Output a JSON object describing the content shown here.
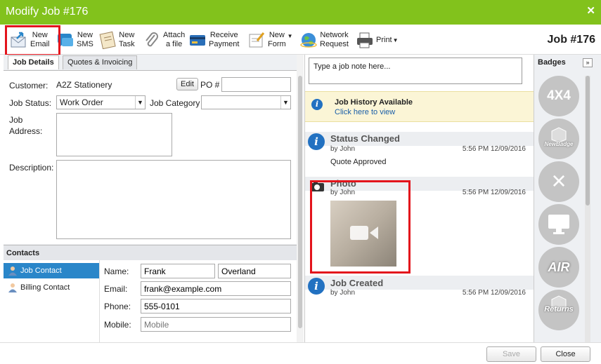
{
  "window": {
    "title": "Modify Job #176",
    "close": "✕"
  },
  "toolbar": {
    "new_email": [
      "New",
      "Email"
    ],
    "new_sms": [
      "New",
      "SMS"
    ],
    "new_task": [
      "New",
      "Task"
    ],
    "attach": [
      "Attach",
      "a file"
    ],
    "receive": [
      "Receive",
      "Payment"
    ],
    "new_form": [
      "New",
      "Form"
    ],
    "network": [
      "Network",
      "Request"
    ],
    "print": "Print"
  },
  "job_title": "Job #176",
  "tabs": [
    "Job Details",
    "Quotes & Invoicing"
  ],
  "form": {
    "customer_label": "Customer:",
    "customer_value": "A2Z Stationery",
    "edit_label": "Edit",
    "po_label": "PO #",
    "po_value": "",
    "status_label": "Job Status:",
    "status_value": "Work Order",
    "category_label": "Job Category",
    "category_value": "",
    "address_label_1": "Job",
    "address_label_2": "Address:",
    "description_label": "Description:"
  },
  "contacts": {
    "header": "Contacts",
    "items": [
      "Job Contact",
      "Billing Contact"
    ],
    "name_label": "Name:",
    "first_name": "Frank",
    "last_name": "Overland",
    "email_label": "Email:",
    "email": "frank@example.com",
    "phone_label": "Phone:",
    "phone": "555-0101",
    "mobile_label": "Mobile:",
    "mobile_placeholder": "Mobile"
  },
  "notes": {
    "placeholder": "Type a job note here...",
    "history_title": "Job History Available",
    "history_link": "Click here to view",
    "entries": [
      {
        "title": "Status Changed",
        "by": "by John",
        "time": "5:56 PM 12/09/2016",
        "body": "Quote Approved"
      },
      {
        "title": "Photo",
        "by": "by John",
        "time": "5:56 PM 12/09/2016"
      },
      {
        "title": "Job Created",
        "by": "by John",
        "time": "5:56 PM 12/09/2016"
      }
    ]
  },
  "badges": {
    "header": "Badges",
    "expand": "»",
    "items": [
      "4X4",
      "NewBadge",
      "×",
      "",
      "AIR",
      "Returns"
    ]
  },
  "footer": {
    "save": "Save",
    "close": "Close"
  },
  "colors": {
    "titlebar": "#82c21c",
    "highlight": "#e3141c",
    "selected": "#2a86c9",
    "info": "#2271c1"
  }
}
